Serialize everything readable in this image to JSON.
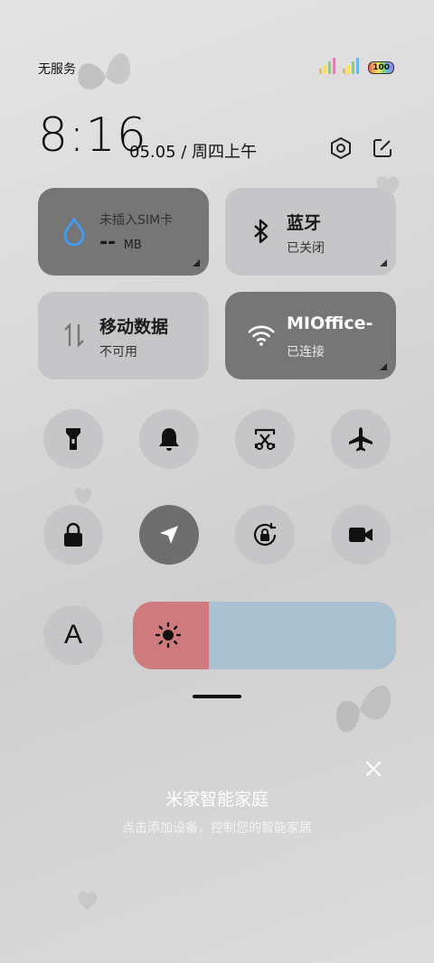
{
  "status_bar": {
    "carrier": "无服务",
    "battery": "100",
    "signal_icon": "signal-bars-icon"
  },
  "header": {
    "time": "8:16",
    "date": "05.05 / 周四上午",
    "settings_icon": "settings-icon",
    "edit_icon": "edit-icon"
  },
  "cards": [
    {
      "key": "data-usage",
      "icon": "water-drop-icon",
      "title": "未插入SIM卡",
      "value": "--",
      "unit": "MB",
      "active": true
    },
    {
      "key": "bluetooth",
      "icon": "bluetooth-icon",
      "title": "蓝牙",
      "subtitle": "已关闭",
      "active": false
    },
    {
      "key": "mobile-data",
      "icon": "data-arrows-icon",
      "title": "移动数据",
      "subtitle": "不可用",
      "active": false
    },
    {
      "key": "wifi",
      "icon": "wifi-icon",
      "title": "MIOffice-",
      "subtitle": "已连接",
      "active": true
    }
  ],
  "toggles_row1": [
    {
      "key": "flashlight",
      "icon": "flashlight-icon",
      "active": false
    },
    {
      "key": "ringer",
      "icon": "bell-icon",
      "active": false
    },
    {
      "key": "screenshot",
      "icon": "scissors-screenshot-icon",
      "active": false
    },
    {
      "key": "airplane",
      "icon": "airplane-icon",
      "active": false
    }
  ],
  "toggles_row2": [
    {
      "key": "lock",
      "icon": "lock-icon",
      "active": false
    },
    {
      "key": "location",
      "icon": "location-arrow-icon",
      "active": true
    },
    {
      "key": "rotation-lock",
      "icon": "rotation-lock-icon",
      "active": false
    },
    {
      "key": "screen-record",
      "icon": "video-camera-icon",
      "active": false
    }
  ],
  "auto_brightness": {
    "label": "A",
    "icon": "auto-brightness-icon"
  },
  "brightness": {
    "level": 0.29,
    "icon": "sun-icon",
    "fill_color": "#cf7a7d",
    "track_color": "#a9c1d0"
  },
  "mijia": {
    "title": "米家智能家庭",
    "subtitle": "点击添加设备，控制您的智能家居",
    "close_icon": "close-icon"
  }
}
